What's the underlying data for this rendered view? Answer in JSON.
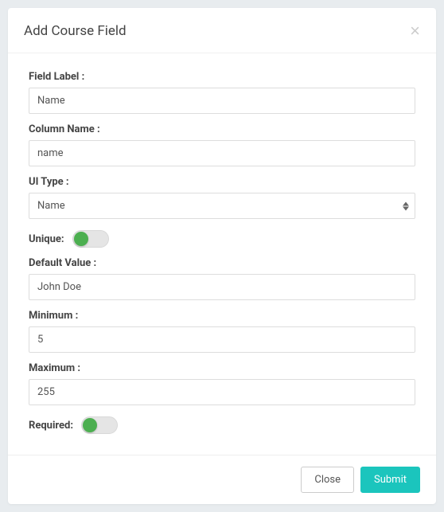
{
  "modal": {
    "title": "Add Course Field"
  },
  "form": {
    "fieldLabel": {
      "label": "Field Label :",
      "value": "Name"
    },
    "columnName": {
      "label": "Column Name :",
      "value": "name"
    },
    "uiType": {
      "label": "UI Type :",
      "value": "Name"
    },
    "unique": {
      "label": "Unique:",
      "checked": true
    },
    "defaultValue": {
      "label": "Default Value :",
      "value": "John Doe"
    },
    "minimum": {
      "label": "Minimum :",
      "value": "5"
    },
    "maximum": {
      "label": "Maximum :",
      "value": "255"
    },
    "required": {
      "label": "Required:",
      "checked": true
    }
  },
  "footer": {
    "close": "Close",
    "submit": "Submit"
  }
}
